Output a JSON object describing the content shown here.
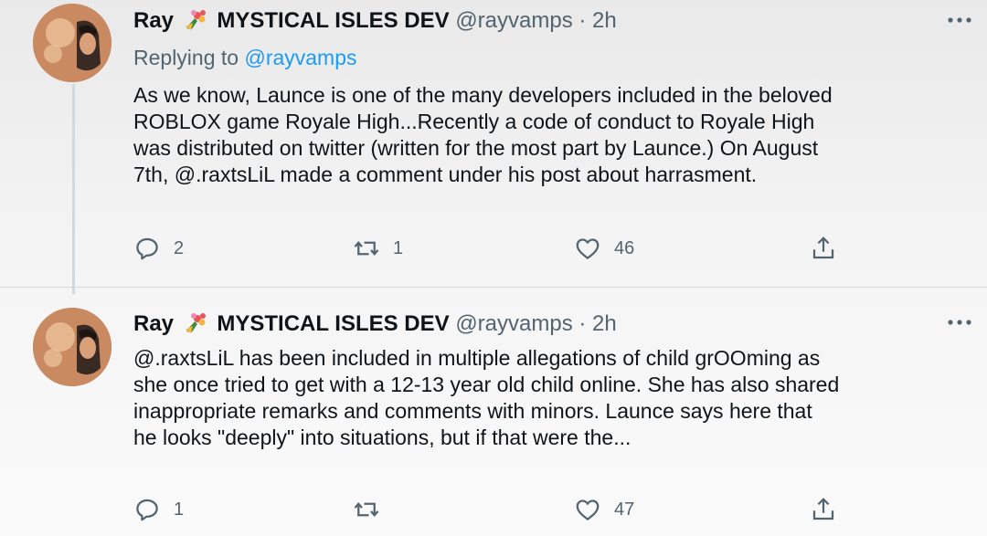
{
  "tweets": [
    {
      "display_name": "Ray",
      "badge": "MYSTICAL ISLES DEV",
      "handle": "@rayvamps",
      "dot": "·",
      "time": "2h",
      "replying_prefix": "Replying to",
      "replying_handle": "@rayvamps",
      "body_lines": [
        "As we know, Launce is one of the many developers included in the beloved",
        "ROBLOX game Royale High...Recently a code of conduct to Royale High",
        "was distributed on twitter (written for the most part by Launce.) On August",
        "7th, @.raxtsLiL made a comment under his post about harrasment."
      ],
      "reply_count": "2",
      "retweet_count": "1",
      "like_count": "46"
    },
    {
      "display_name": "Ray",
      "badge": "MYSTICAL ISLES DEV",
      "handle": "@rayvamps",
      "dot": "·",
      "time": "2h",
      "body_lines": [
        "@.raxtsLiL has been included in multiple allegations of child grOOming as",
        "she once tried to get with a 12-13 year old child online. She has also shared",
        "inappropriate remarks and comments with minors. Launce says here that",
        "he looks \"deeply\" into situations, but if that were the..."
      ],
      "reply_count": "1",
      "retweet_count": "",
      "like_count": "47"
    }
  ],
  "icons": {
    "badge": "bouquet-icon",
    "more": "more-icon",
    "reply": "reply-icon",
    "retweet": "retweet-icon",
    "like": "like-icon",
    "share": "share-icon"
  },
  "colors": {
    "text": "#0f1419",
    "secondary": "#536471",
    "link": "#1d9bf0",
    "thread_line": "#cfd9de"
  }
}
